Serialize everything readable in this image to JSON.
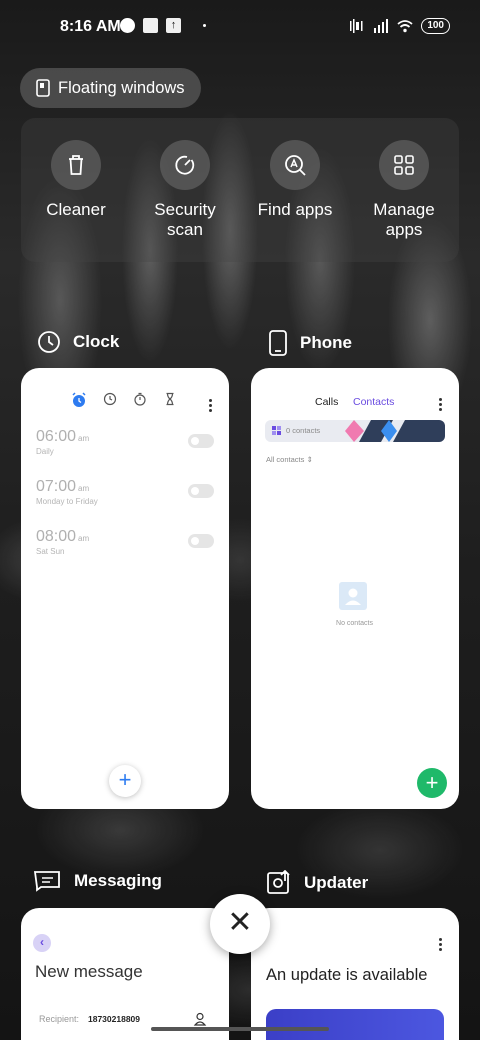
{
  "status_bar": {
    "time": "8:16 AM",
    "battery": "100",
    "icons": [
      "data-saver-icon",
      "square-notification-icon",
      "upload-notification-icon",
      "dot-icon",
      "vibrate-icon",
      "signal-icon",
      "wifi-icon",
      "battery-icon"
    ]
  },
  "floating_windows": {
    "label": "Floating windows",
    "icon": "floating-window-icon"
  },
  "quick_actions": [
    {
      "label": "Cleaner",
      "icon": "trash-icon"
    },
    {
      "label": "Security\nscan",
      "icon": "security-scan-icon"
    },
    {
      "label": "Find apps",
      "icon": "find-apps-icon"
    },
    {
      "label": "Manage\napps",
      "icon": "grid-icon"
    }
  ],
  "apps": {
    "clock": {
      "name": "Clock",
      "alarms": [
        {
          "time": "06:00",
          "ampm": "am",
          "repeat": "Daily"
        },
        {
          "time": "07:00",
          "ampm": "am",
          "repeat": "Monday to Friday"
        },
        {
          "time": "08:00",
          "ampm": "am",
          "repeat": "Sat Sun"
        }
      ],
      "add_label": "+"
    },
    "phone": {
      "name": "Phone",
      "tab_calls": "Calls",
      "tab_contacts": "Contacts",
      "contacts_count": "0 contacts",
      "all_contacts": "All contacts",
      "no_contacts": "No contacts",
      "add_label": "+"
    },
    "messaging": {
      "name": "Messaging",
      "title": "New message",
      "recipient_label": "Recipient:",
      "recipient_value": "18730218809"
    },
    "updater": {
      "name": "Updater",
      "title": "An update is available"
    }
  },
  "close_label": "✕",
  "colors": {
    "accent_purple": "#6a4ce0",
    "accent_blue": "#2d7bf0",
    "fab_green": "#1fb96a"
  }
}
